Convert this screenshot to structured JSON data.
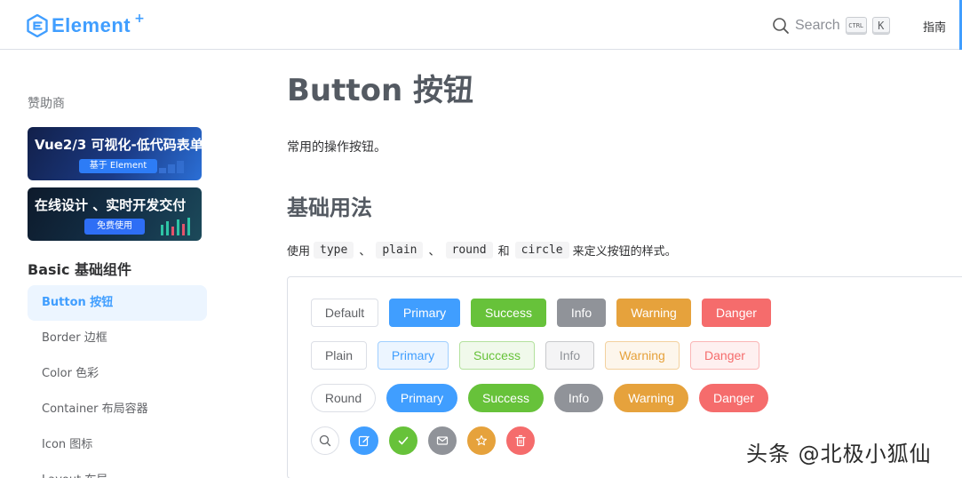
{
  "header": {
    "logo_text": "Element",
    "logo_plus": "+",
    "search_label": "Search",
    "kbd_ctrl": "CTRL",
    "kbd_k": "K",
    "nav_guide": "指南"
  },
  "sidebar": {
    "sponsor_title": "赞助商",
    "banners": [
      {
        "title": "Vue2/3 可视化-低代码表单",
        "pill": "基于 Element"
      },
      {
        "title": "在线设计 、实时开发交付",
        "pill": "免费使用"
      }
    ],
    "group_title": "Basic 基础组件",
    "items": [
      {
        "label": "Button 按钮",
        "active": true
      },
      {
        "label": "Border 边框"
      },
      {
        "label": "Color 色彩"
      },
      {
        "label": "Container 布局容器"
      },
      {
        "label": "Icon 图标"
      },
      {
        "label": "Layout 布局"
      }
    ]
  },
  "main": {
    "title": "Button 按钮",
    "description": "常用的操作按钮。",
    "section_title": "基础用法",
    "usage": {
      "prefix": "使用",
      "code1": "type",
      "sep1": "、",
      "code2": "plain",
      "sep2": "、",
      "code3": "round",
      "and": "和",
      "code4": "circle",
      "suffix": "来定义按钮的样式。"
    },
    "demo": {
      "row_default": [
        "Default",
        "Primary",
        "Success",
        "Info",
        "Warning",
        "Danger"
      ],
      "row_plain": [
        "Plain",
        "Primary",
        "Success",
        "Info",
        "Warning",
        "Danger"
      ],
      "row_round": [
        "Round",
        "Primary",
        "Success",
        "Info",
        "Warning",
        "Danger"
      ],
      "row_circle_icons": [
        "search-icon",
        "edit-icon",
        "check-icon",
        "message-icon",
        "star-icon",
        "delete-icon"
      ]
    }
  },
  "watermark": "头条 @北极小狐仙",
  "colors": {
    "primary": "#409eff",
    "success": "#67c23a",
    "info": "#909399",
    "warning": "#e6a23c",
    "danger": "#f56c6c"
  }
}
